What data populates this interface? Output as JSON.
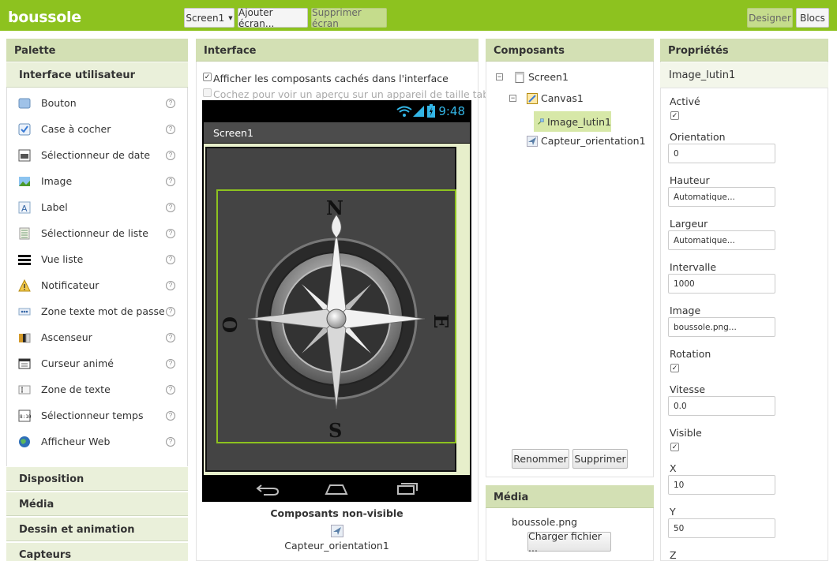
{
  "app": {
    "title": "boussole"
  },
  "toolbar": {
    "screen_select": "Screen1",
    "add_screen": "Ajouter écran...",
    "remove_screen": "Supprimer écran",
    "designer": "Designer",
    "blocks": "Blocs"
  },
  "palette": {
    "title": "Palette",
    "section": "Interface utilisateur",
    "items": [
      {
        "label": "Bouton",
        "icon": "button-icon"
      },
      {
        "label": "Case à cocher",
        "icon": "checkbox-icon"
      },
      {
        "label": "Sélectionneur de date",
        "icon": "datepicker-icon"
      },
      {
        "label": "Image",
        "icon": "image-icon"
      },
      {
        "label": "Label",
        "icon": "label-icon"
      },
      {
        "label": "Sélectionneur de liste",
        "icon": "listpicker-icon"
      },
      {
        "label": "Vue liste",
        "icon": "listview-icon"
      },
      {
        "label": "Notificateur",
        "icon": "notifier-icon"
      },
      {
        "label": "Zone texte mot de passe",
        "icon": "password-icon"
      },
      {
        "label": "Ascenseur",
        "icon": "slider-icon"
      },
      {
        "label": "Curseur animé",
        "icon": "spinner-icon"
      },
      {
        "label": "Zone de texte",
        "icon": "textbox-icon"
      },
      {
        "label": "Sélectionneur temps",
        "icon": "timepicker-icon"
      },
      {
        "label": "Afficheur Web",
        "icon": "webviewer-icon"
      }
    ],
    "help": "?",
    "categories": [
      "Disposition",
      "Média",
      "Dessin et animation",
      "Capteurs"
    ]
  },
  "viewer": {
    "title": "Interface",
    "show_hidden": "Afficher les composants cachés dans l'interface",
    "tablet_preview": "Cochez pour voir un aperçu sur un appareil de taille tablette.",
    "time": "9:48",
    "screen_title": "Screen1",
    "compass": {
      "n": "N",
      "s": "S",
      "e": "E",
      "w": "O"
    },
    "nonvisible_title": "Composants non-visible",
    "nonvisible_item": "Capteur_orientation1"
  },
  "components": {
    "title": "Composants",
    "tree": [
      {
        "label": "Screen1",
        "toggle": "⊟"
      },
      {
        "label": "Canvas1",
        "toggle": "⊟"
      },
      {
        "label": "Image_lutin1"
      },
      {
        "label": "Capteur_orientation1"
      }
    ],
    "rename": "Renommer",
    "delete": "Supprimer"
  },
  "media": {
    "title": "Média",
    "file": "boussole.png",
    "upload": "Charger fichier ..."
  },
  "properties": {
    "title": "Propriétés",
    "component": "Image_lutin1",
    "items": [
      {
        "label": "Activé",
        "type": "checkbox",
        "checked": true
      },
      {
        "label": "Orientation",
        "type": "input",
        "value": "0"
      },
      {
        "label": "Hauteur",
        "type": "input",
        "value": "Automatique..."
      },
      {
        "label": "Largeur",
        "type": "input",
        "value": "Automatique..."
      },
      {
        "label": "Intervalle",
        "type": "input",
        "value": "1000"
      },
      {
        "label": "Image",
        "type": "input",
        "value": "boussole.png..."
      },
      {
        "label": "Rotation",
        "type": "checkbox",
        "checked": true
      },
      {
        "label": "Vitesse",
        "type": "input",
        "value": "0.0"
      },
      {
        "label": "Visible",
        "type": "checkbox",
        "checked": true
      },
      {
        "label": "X",
        "type": "input",
        "value": "10"
      },
      {
        "label": "Y",
        "type": "input",
        "value": "50"
      },
      {
        "label": "Z",
        "type": "input",
        "value": ""
      }
    ]
  },
  "colors": {
    "accent": "#8dc21f",
    "panel_header": "#d3e0b4",
    "time": "#33b5e5"
  }
}
